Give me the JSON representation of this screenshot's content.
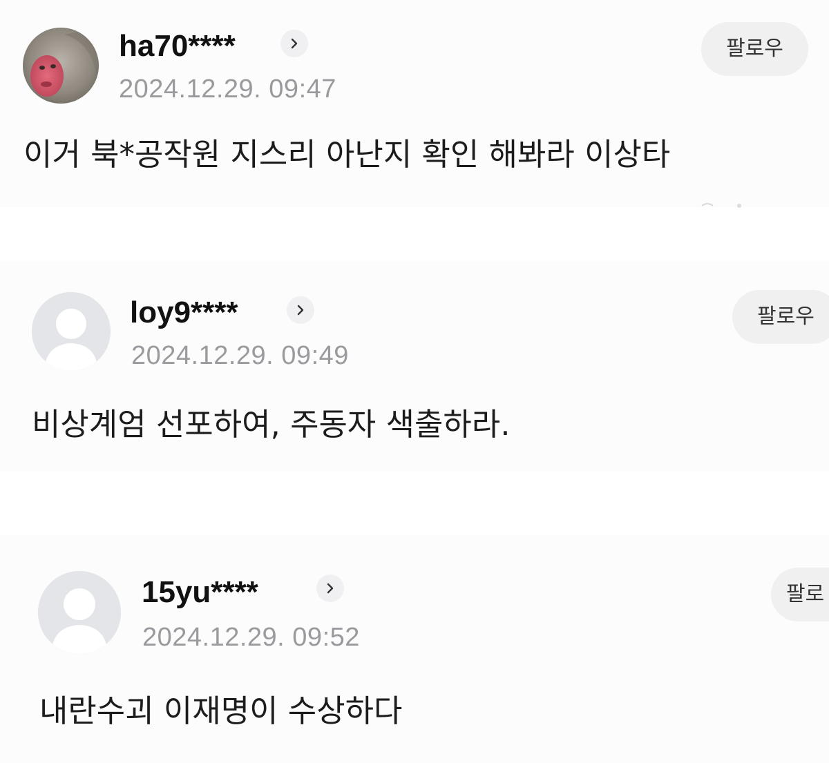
{
  "comments": [
    {
      "username": "ha70****",
      "timestamp": "2024.12.29. 09:47",
      "follow_label": "팔로우",
      "text": "이거 북*공작원 지스리 아난지 확인 해봐라 이상타",
      "avatar_icon": "monkey-photo-avatar"
    },
    {
      "username": "loy9****",
      "timestamp": "2024.12.29. 09:49",
      "follow_label": "팔로우",
      "text": "비상계엄 선포하여, 주동자 색출하라.",
      "avatar_icon": "default-user-avatar"
    },
    {
      "username": "15yu****",
      "timestamp": "2024.12.29. 09:52",
      "follow_label": "팔로",
      "text": "내란수괴 이재명이 수상하다",
      "avatar_icon": "default-user-avatar"
    }
  ],
  "colors": {
    "username": "#111111",
    "timestamp": "#9a9a9e",
    "follow_bg": "#f0f0f0",
    "avatar_bg": "#e3e5e8"
  }
}
